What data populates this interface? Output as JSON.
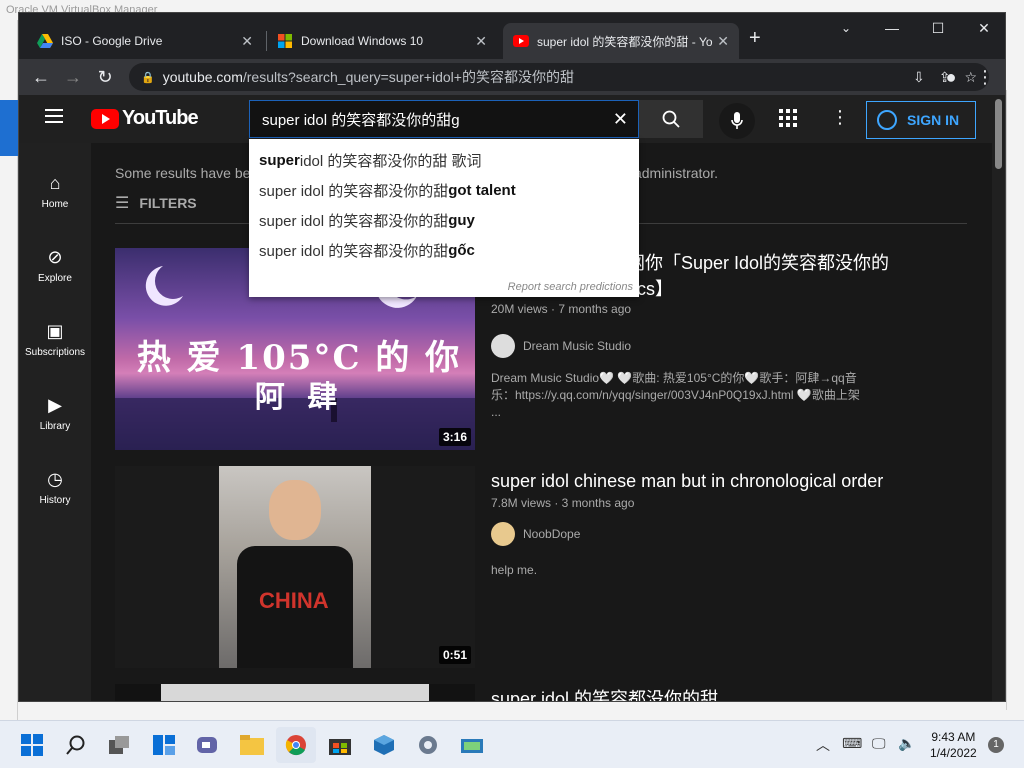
{
  "background": {
    "title_fragment": "Oracle VM VirtualBox Manager"
  },
  "browser": {
    "tabs": [
      {
        "label": "ISO - Google Drive",
        "icon": "google-drive-icon"
      },
      {
        "label": "Download Windows 10",
        "icon": "windows-icon"
      },
      {
        "label": "super idol 的笑容都没你的甜 - Yo",
        "icon": "youtube-icon"
      }
    ],
    "new_tab_symbol": "+",
    "url_host": "youtube.com",
    "url_path": "/results?search_query=super+idol+的笑容都没你的甜",
    "win_controls": {
      "minimize": "—",
      "maximize": "☐",
      "close": "✕"
    }
  },
  "youtube": {
    "logo_text": "YouTube",
    "search": {
      "value": "super idol 的笑容都没你的甜g",
      "suggestions": [
        {
          "prefix": "super",
          "rest": "idol 的笑容都没你的甜 歌词",
          "bold_prefix": true
        },
        {
          "prefix": "super idol 的笑容都没你的甜",
          "rest": "got talent",
          "bold_rest": true
        },
        {
          "prefix": "super idol 的笑容都没你的甜",
          "rest": "guy",
          "bold_rest": true
        },
        {
          "prefix": "super idol 的笑容都没你的甜",
          "rest": "gốc",
          "bold_rest": true
        }
      ],
      "report": "Report search predictions"
    },
    "signin_label": "SIGN IN",
    "guide": [
      {
        "label": "Home",
        "icon": "home-icon"
      },
      {
        "label": "Explore",
        "icon": "compass-icon"
      },
      {
        "label": "Subscriptions",
        "icon": "subscriptions-icon"
      },
      {
        "label": "Library",
        "icon": "library-icon"
      },
      {
        "label": "History",
        "icon": "history-icon"
      }
    ],
    "notice": "Some results have been removed because Restricted Mode is enabled by your network administrator.",
    "notice_left": "Some results have be",
    "notice_right": "rk administrator.",
    "filters_label": "FILTERS",
    "videos": [
      {
        "title_line1": "网你「Super Idol的笑容都没你的",
        "title_line2": "rics】",
        "meta": "20M views · 7 months ago",
        "channel": "Dream Music Studio",
        "description": "Dream Music Studio🤍 🤍歌曲: 热爱105°C的你🤍歌手：阿肆→qq音乐：https://y.qq.com/n/yqq/singer/003VJ4nP0Q19xJ.html 🤍歌曲上架 ...",
        "thumb_text_1": "热 爱 105°C 的 你",
        "thumb_text_2": "阿 肆",
        "duration": "3:16"
      },
      {
        "title": "super idol chinese man but in chronological order",
        "meta": "7.8M views · 3 months ago",
        "channel": "NoobDope",
        "description": "help me.",
        "shirt_text": "CHINA",
        "duration": "0:51"
      },
      {
        "title": "super idol 的笑容都没你的甜",
        "meta": "…",
        "duration": ""
      }
    ]
  },
  "taskbar": {
    "time": "9:43 AM",
    "date": "1/4/2022",
    "notification_count": "1"
  }
}
